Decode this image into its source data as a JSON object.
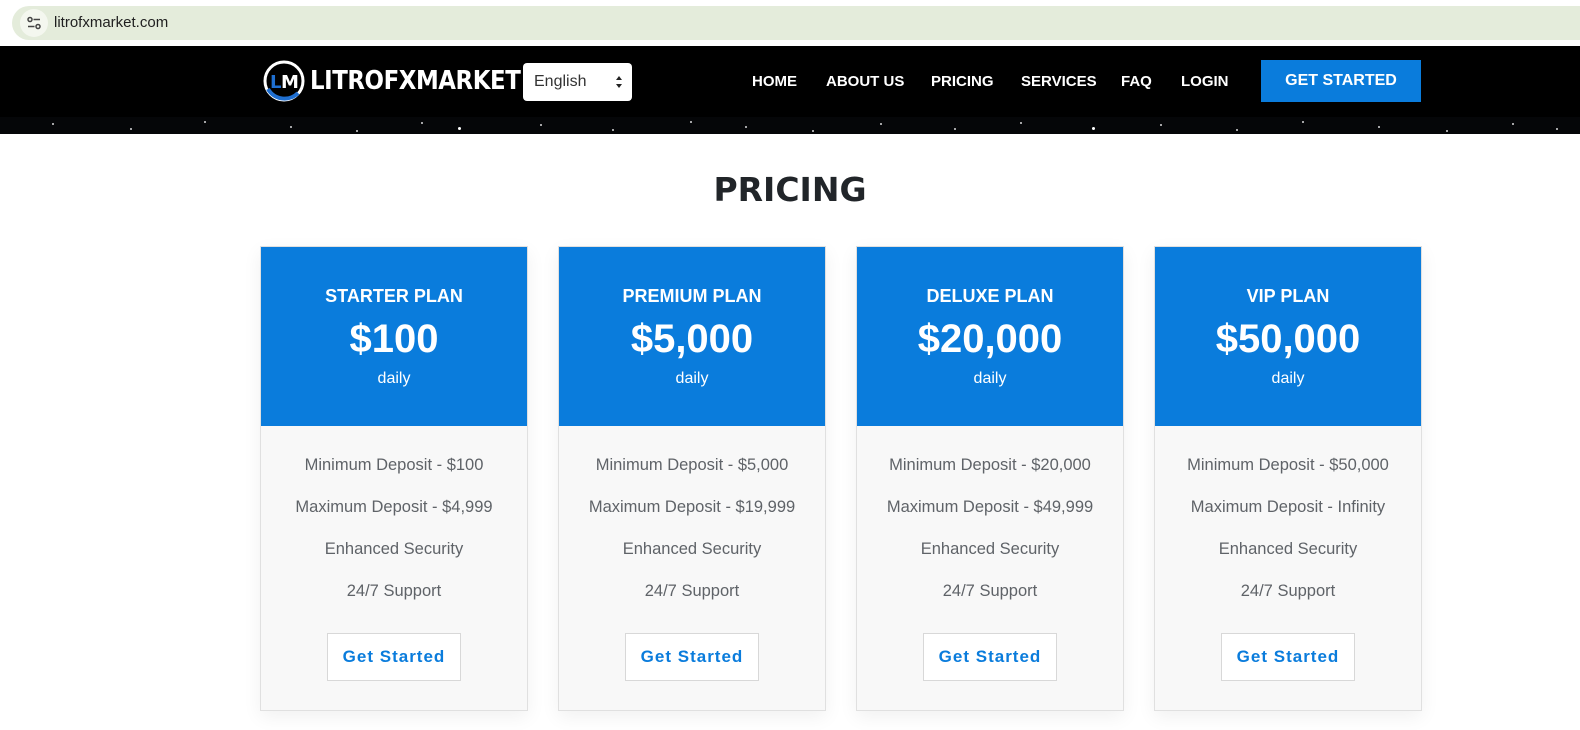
{
  "browser": {
    "url": "litrofxmarket.com",
    "site_info_icon": "tune-icon"
  },
  "header": {
    "logo_text": "LITROFXMARKET",
    "logo_icon": "lm-logo-icon",
    "language": "English",
    "nav": [
      "HOME",
      "ABOUT US",
      "PRICING",
      "SERVICES",
      "FAQ",
      "LOGIN"
    ],
    "cta_label": "GET STARTED"
  },
  "pricing": {
    "title": "PRICING",
    "plans": [
      {
        "name": "STARTER PLAN",
        "price": "$100",
        "period": "daily",
        "features": [
          "Minimum Deposit - $100",
          "Maximum Deposit - $4,999",
          "Enhanced Security",
          "24/7 Support"
        ],
        "button": "Get Started"
      },
      {
        "name": "PREMIUM PLAN",
        "price": "$5,000",
        "period": "daily",
        "features": [
          "Minimum Deposit - $5,000",
          "Maximum Deposit - $19,999",
          "Enhanced Security",
          "24/7 Support"
        ],
        "button": "Get Started"
      },
      {
        "name": "DELUXE PLAN",
        "price": "$20,000",
        "period": "daily",
        "features": [
          "Minimum Deposit - $20,000",
          "Maximum Deposit - $49,999",
          "Enhanced Security",
          "24/7 Support"
        ],
        "button": "Get Started"
      },
      {
        "name": "VIP PLAN",
        "price": "$50,000",
        "period": "daily",
        "features": [
          "Minimum Deposit - $50,000",
          "Maximum Deposit - Infinity",
          "Enhanced Security",
          "24/7 Support"
        ],
        "button": "Get Started"
      }
    ]
  },
  "colors": {
    "accent": "#0a7cdc",
    "nav_bg": "#000000",
    "url_bar": "#e4ecdb"
  }
}
